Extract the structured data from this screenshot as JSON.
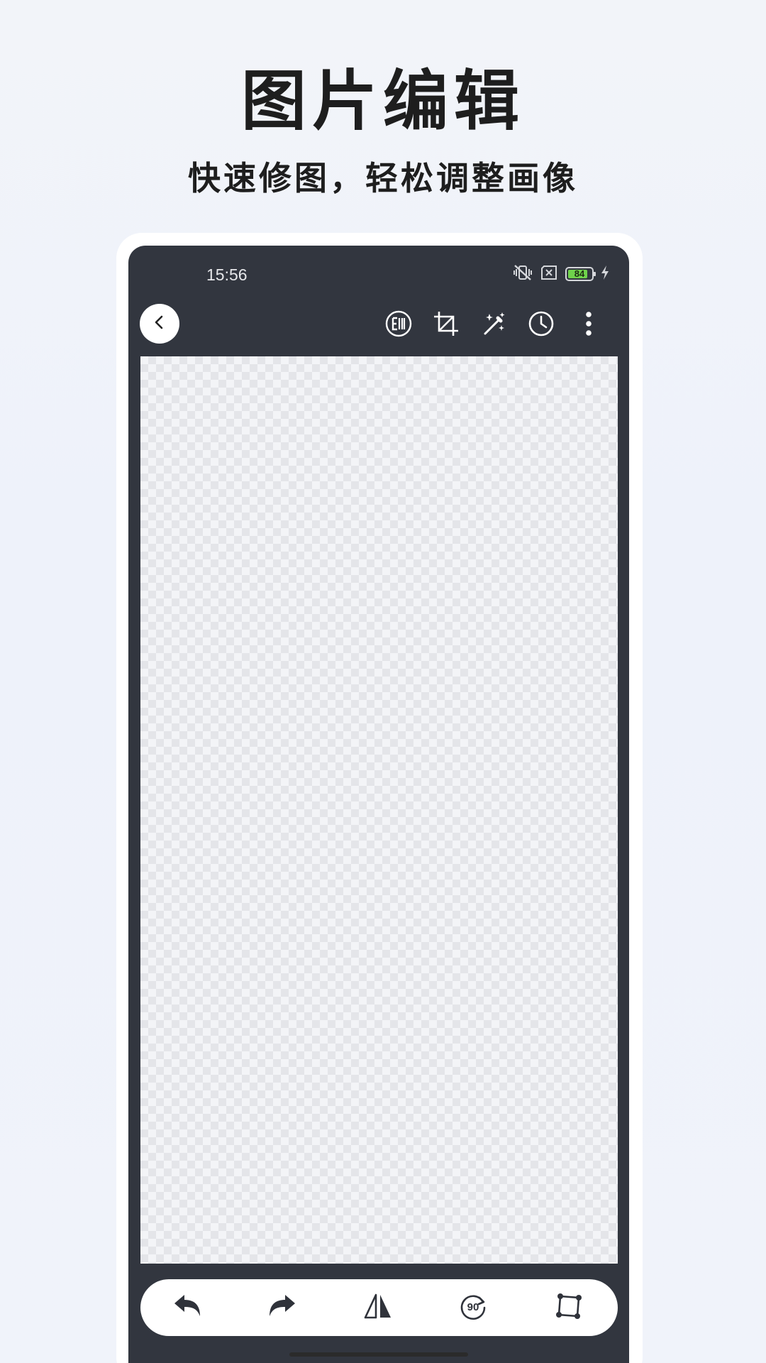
{
  "promo": {
    "title": "图片编辑",
    "subtitle": "快速修图，轻松调整画像"
  },
  "status_bar": {
    "time": "15:56",
    "battery_level": "84",
    "battery_fraction": 0.84,
    "icons": [
      "vibrate-muted-icon",
      "sim-error-icon",
      "battery-icon",
      "charging-bolt-icon"
    ]
  },
  "toolbar": {
    "back_icon": "chevron-left-icon",
    "tools": [
      "edit-mode-icon",
      "crop-icon",
      "magic-wand-icon",
      "history-clock-icon",
      "more-vertical-icon"
    ]
  },
  "bottom_bar": {
    "tools": [
      "undo-icon",
      "redo-icon",
      "flip-icon",
      "rotate-90-icon",
      "transform-icon"
    ],
    "rotate_label": "90"
  },
  "colors": {
    "screen_bg": "#32363f",
    "canvas_light": "#f3f4f7",
    "canvas_dark": "#e4e5e9",
    "battery_fill": "#6fd24b"
  }
}
